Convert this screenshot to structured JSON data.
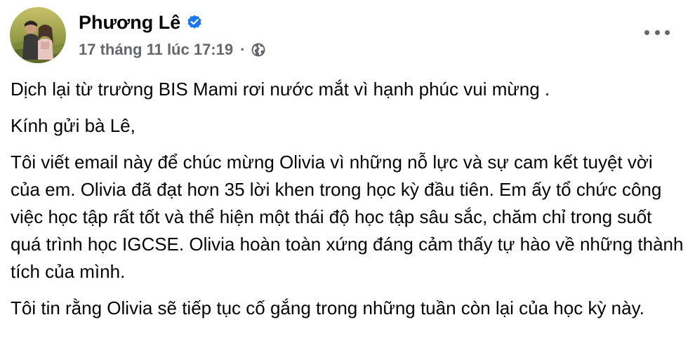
{
  "post": {
    "author": {
      "name": "Phương Lê",
      "verified": true
    },
    "timestamp": "17 tháng 11 lúc 17:19",
    "separator": "·",
    "audience_icon": "globe-icon",
    "more_icon": "more-options-icon",
    "body": {
      "p1": "Dịch lại từ trường BIS Mami rơi nước mắt vì hạnh phúc vui mừng .",
      "p2": "Kính gửi bà Lê,",
      "p3": "Tôi viết email này để chúc mừng Olivia vì những nỗ lực và sự cam kết tuyệt vời của em. Olivia đã đạt hơn 35 lời khen trong học kỳ đầu tiên. Em ấy tổ chức công việc học tập rất tốt và thể hiện một thái độ học tập sâu sắc, chăm chỉ trong suốt quá trình học IGCSE. Olivia hoàn toàn xứng đáng cảm thấy tự hào về những thành tích của mình.",
      "p4": "Tôi tin rằng Olivia sẽ tiếp tục cố gắng trong những tuần còn lại của học kỳ này."
    }
  },
  "colors": {
    "text_primary": "#050505",
    "text_secondary": "#65676b",
    "verified_blue": "#1877f2",
    "background": "#ffffff"
  }
}
